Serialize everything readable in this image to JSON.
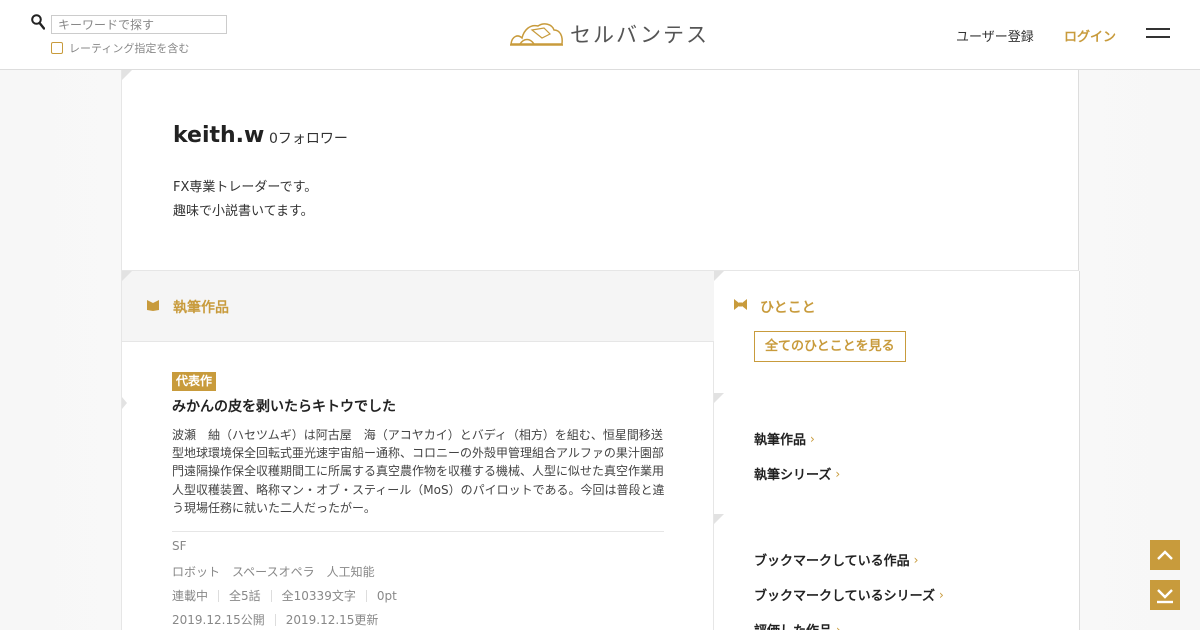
{
  "header": {
    "search_placeholder": "キーワードで探す",
    "rating_label": "レーティング指定を含む",
    "logo_text": "セルバンテス",
    "register_label": "ユーザー登録",
    "login_label": "ログイン"
  },
  "profile": {
    "name": "keith.w",
    "followers": "0フォロワー",
    "bio": [
      "FX専業トレーダーです。",
      "趣味で小説書いてます。"
    ]
  },
  "works": {
    "title": "執筆作品",
    "featured": {
      "badge": "代表作",
      "title": "みかんの皮を剥いたらキトウでした",
      "description": "波瀬　紬（ハセツムギ）は阿古屋　海（アコヤカイ）とバディ（相方）を組む、恒星間移送型地球環境保全回転式亜光速宇宙船ー通称、コロニーの外殻甲管理組合アルファの果汁園部門遠隔操作保全収穫期間工に所属する真空農作物を収穫する機械、人型に似せた真空作業用人型収穫装置、略称マン・オブ・スティール（MoS）のパイロットである。今回は普段と違う現場任務に就いた二人だったがー。",
      "genre": "SF",
      "tags": [
        "ロボット",
        "スペースオペラ",
        "人工知能"
      ],
      "status": "連載中",
      "episodes": "全5話",
      "chars": "全10339文字",
      "points": "0pt",
      "published": "2019.12.15公開",
      "updated": "2019.12.15更新"
    }
  },
  "sidebar": {
    "hitokoto_title": "ひとこと",
    "all_hitokoto_label": "全てのひとことを見る",
    "links_group1": [
      "執筆作品",
      "執筆シリーズ"
    ],
    "links_group2": [
      "ブックマークしている作品",
      "ブックマークしているシリーズ",
      "評価した作品"
    ]
  },
  "colors": {
    "accent": "#c89b3c",
    "text": "#222222",
    "muted": "#888888"
  },
  "icons": [
    "search-icon",
    "logo-icon",
    "menu-icon",
    "book-icon",
    "bowtie-icon",
    "chevron-right-icon",
    "chevron-up-icon",
    "chevron-down-bottom-icon"
  ]
}
